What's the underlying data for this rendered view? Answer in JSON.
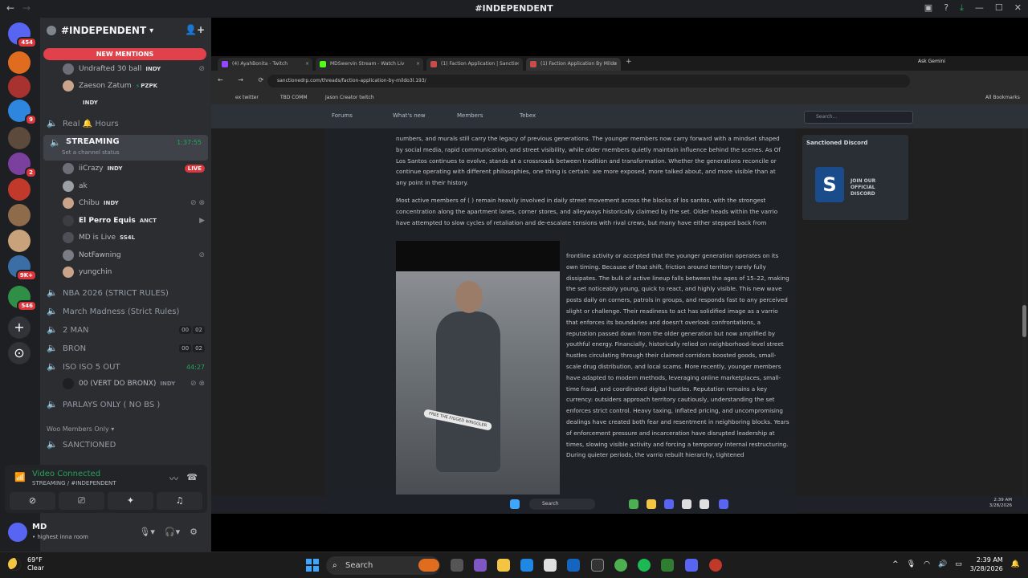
{
  "titlebar": {
    "title": "#INDEPENDENT",
    "back": "←",
    "forward": "→"
  },
  "rail": {
    "servers": [
      {
        "name": "Direct Messages",
        "badge": "454",
        "color": "#5865f2"
      },
      {
        "name": "server-1",
        "badge": "",
        "color": "#e06c1f"
      },
      {
        "name": "server-2",
        "badge": "",
        "color": "#a8322f"
      },
      {
        "name": "server-3",
        "badge": "9",
        "color": "#2e86de"
      },
      {
        "name": "server-4",
        "badge": "",
        "color": "#5c4a3c"
      },
      {
        "name": "server-5",
        "badge": "2",
        "color": "#7b3f9e"
      },
      {
        "name": "server-6",
        "badge": "",
        "color": "#c0392b"
      },
      {
        "name": "server-7",
        "badge": "",
        "color": "#8e6b4b"
      },
      {
        "name": "server-8",
        "badge": "",
        "color": "#c8a27a"
      },
      {
        "name": "server-9",
        "badge": "9K+",
        "color": "#3b6ea5"
      },
      {
        "name": "server-10",
        "badge": "546",
        "color": "#2f8f46"
      }
    ],
    "add_server": "+",
    "discover": "⊙"
  },
  "guild": {
    "name": "#INDEPENDENT",
    "new_mentions": "NEW MENTIONS"
  },
  "channels": {
    "top_users": [
      {
        "name": "Undrafted 30 ball",
        "tag": "INDY",
        "tag_icon": "",
        "right": "mute"
      },
      {
        "name": "Zaeson Zatum",
        "tag": "PZPK",
        "tag_icon": "⚡",
        "right": ""
      },
      {
        "name": "",
        "tag": "INDY",
        "tag_icon": "",
        "right": ""
      }
    ],
    "real_hours": "Real 🔔 Hours",
    "streaming": {
      "name": "STREAMING",
      "timer": "1:37:55",
      "status": "Set a channel status"
    },
    "stream_users": [
      {
        "name": "iiCrazy",
        "tag": "INDY",
        "bold": false,
        "right": "LIVE"
      },
      {
        "name": "ak",
        "tag": "",
        "bold": false,
        "right": ""
      },
      {
        "name": "Chibu",
        "tag": "INDY",
        "bold": false,
        "right": "icons"
      },
      {
        "name": "El Perro Equis",
        "tag": "ANCT",
        "bold": true,
        "right": "cam"
      },
      {
        "name": "MD is Live",
        "tag": "SS4L",
        "bold": false,
        "right": ""
      },
      {
        "name": "NotFawning",
        "tag": "",
        "bold": false,
        "right": "mute"
      },
      {
        "name": "yungchin",
        "tag": "",
        "bold": false,
        "right": ""
      }
    ],
    "voice_channels": [
      {
        "name": "NBA 2026 (STRICT RULES)",
        "counts": []
      },
      {
        "name": "March Madness (Strict Rules)",
        "counts": []
      },
      {
        "name": "2 MAN",
        "counts": [
          "00",
          "02"
        ]
      },
      {
        "name": "BRON",
        "counts": [
          "00",
          "02"
        ]
      },
      {
        "name": "ISO ISO 5 OUT",
        "timer": "44:27",
        "counts": []
      }
    ],
    "iso_user": {
      "name": "00 (VERT DO BRONX)",
      "tag": "INDY"
    },
    "parlays": "PARLAYS ONLY ( NO BS )",
    "category": "Woo Members Only",
    "sanctioned": "SANCTIONED"
  },
  "voice_panel": {
    "status": "Video Connected",
    "location": "STREAMING / #INDEPENDENT"
  },
  "user_panel": {
    "name": "MD",
    "status": "• highest inna room"
  },
  "browser": {
    "tabs": [
      {
        "label": "(4) AyahBonita - Twitch",
        "color": "#9146ff"
      },
      {
        "label": "MDSwervin Stream - Watch Liv",
        "color": "#53fc18"
      },
      {
        "label": "(1) Faction Application | Sanctio",
        "color": "#c94b4b"
      },
      {
        "label": "(1) Faction Application By Mildo",
        "color": "#c94b4b"
      }
    ],
    "ask_gemini": "Ask Gemini",
    "url": "sanctionedrp.com/threads/faction-application-by-mildo3l.193/",
    "bookmarks": [
      "ex twitter",
      "TBD COMM",
      "Jason Creator twitch"
    ],
    "all_bookmarks": "All Bookmarks",
    "site_nav": [
      "Forums",
      "What's new",
      "Members",
      "Tebex"
    ],
    "search_placeholder": "Search...",
    "paragraphs": [
      "numbers, and murals still carry the legacy of previous generations. The younger members now carry       forward with a mindset shaped by social media, rapid communication, and street visibility, while older members quietly maintain influence behind the scenes. As                Of Los Santos continues to evolve,          stands at a crossroads between tradition and transformation. Whether the generations reconcile or continue operating with different philosophies, one thing is certain:                  are more exposed, more talked about, and more visible than at any point in their history.",
      "Most active members of                    (        ) remain heavily involved in daily street movement across the              blocks of los santos, with the strongest concentration along the apartment lanes, corner stores, and alleyways historically claimed by the set. Older heads within the varrio have attempted to slow cycles of retaliation and de-escalate tensions with rival crews, but many have either stepped back from"
    ],
    "side_text": "frontline activity or accepted that the younger generation operates on its own timing. Because of that shift, friction around        territory rarely fully dissipates. The bulk of        active lineup falls between the ages of 15–22, making the set noticeably young, quick to react, and highly visible. This new wave posts daily on corners, patrols in groups, and responds fast to any perceived slight or challenge. Their readiness to act has solidified        image as a varrio that enforces its boundaries and doesn't overlook confrontations, a reputation passed down from the older generation but now amplified by youthful energy. Financially,        historically relied on neighborhood-level street hustles circulating through their claimed corridors boosted goods, small-scale drug distribution, and local scams. More recently, younger members have adapted to modern methods, leveraging online marketplaces, small-time fraud, and coordinated digital hustles. Reputation remains a key currency: outsiders approach        territory cautiously, understanding the set enforces strict control. Heavy taxing, inflated pricing, and uncompromising dealings have created both fear and resentment in neighboring blocks. Years of enforcement pressure and incarceration have disrupted        leadership at times, slowing visible activity and forcing a temporary internal restructuring. During quieter periods, the varrio rebuilt hierarchy, tightened",
    "video_caption": "FREE THE FIGGED WRIGGLER",
    "side_panel": {
      "title": "Sanctioned Discord",
      "logo": "S",
      "join": "JOIN OUR OFFICIAL DISCORD"
    },
    "inner_taskbar": {
      "search": "Search",
      "time": "2:39 AM",
      "date": "3/28/2026"
    }
  },
  "taskbar": {
    "weather_temp": "69°F",
    "weather_desc": "Clear",
    "search": "Search",
    "time": "2:39 AM",
    "date": "3/28/2026"
  }
}
